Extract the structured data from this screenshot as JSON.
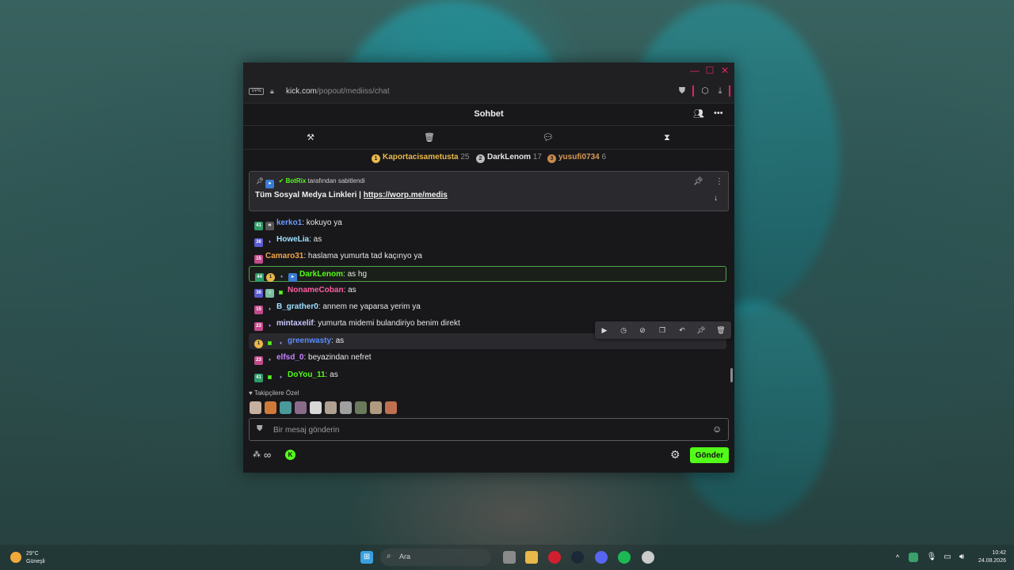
{
  "browser": {
    "vpn_label": "VPN",
    "url_host": "kick.com",
    "url_path": "/popout/mediiss/chat"
  },
  "chat": {
    "title": "Sohbet",
    "leaderboard": [
      {
        "rank": "1",
        "name": "Kaportacisametusta",
        "count": "25",
        "color": "#e8b84a"
      },
      {
        "rank": "2",
        "name": "DarkLenom",
        "count": "17",
        "color": "#e6e6e6"
      },
      {
        "rank": "3",
        "name": "yusufi0734",
        "count": "6",
        "color": "#d89a55"
      }
    ],
    "pinned": {
      "by_user": "BotRix",
      "by_suffix": "tarafından sabitlendi",
      "message": "Tüm Sosyal Medya Linkleri |",
      "link": "https://worp.me/medis"
    },
    "messages": [
      {
        "user": "kerko1",
        "text": ": kokuyo ya",
        "color": "#6b9bff"
      },
      {
        "user": "HoweLia",
        "text": ": as",
        "color": "#9fe0ff"
      },
      {
        "user": "Camaro31",
        "text": ": haslama yumurta tad kaçınyo ya",
        "color": "#f0a44a"
      },
      {
        "user": "DarkLenom",
        "text": ": as hg",
        "color": "#53fc18"
      },
      {
        "user": "NonameCoban",
        "text": ": as",
        "color": "#ff5ea0"
      },
      {
        "user": "B_grather0",
        "text": ": annem ne yaparsa yerim ya",
        "color": "#9fe0ff"
      },
      {
        "user": "mintaxelif",
        "text": ": yumurta midemi bulandiriyo benim direkt",
        "color": "#c8c8ff"
      },
      {
        "user": "greenwasty",
        "text": ": as",
        "color": "#5a8cff"
      },
      {
        "user": "elfsd_0",
        "text": ": beyazindan nefret",
        "color": "#c882ff"
      },
      {
        "user": "DoYou_11",
        "text": ": as",
        "color": "#53fc18"
      }
    ],
    "emote_section_title": "Takipçilere Özel",
    "input_placeholder": "Bir mesaj gönderin",
    "send_label": "Gönder",
    "infinity_label": "∞"
  },
  "taskbar": {
    "temperature": "29°C",
    "weather": "Güneşli",
    "search_label": "Ara",
    "time": "10:42",
    "date": "24.08.2026"
  },
  "colors": {
    "kick_green": "#53fc18",
    "window_bg": "#18181b"
  }
}
